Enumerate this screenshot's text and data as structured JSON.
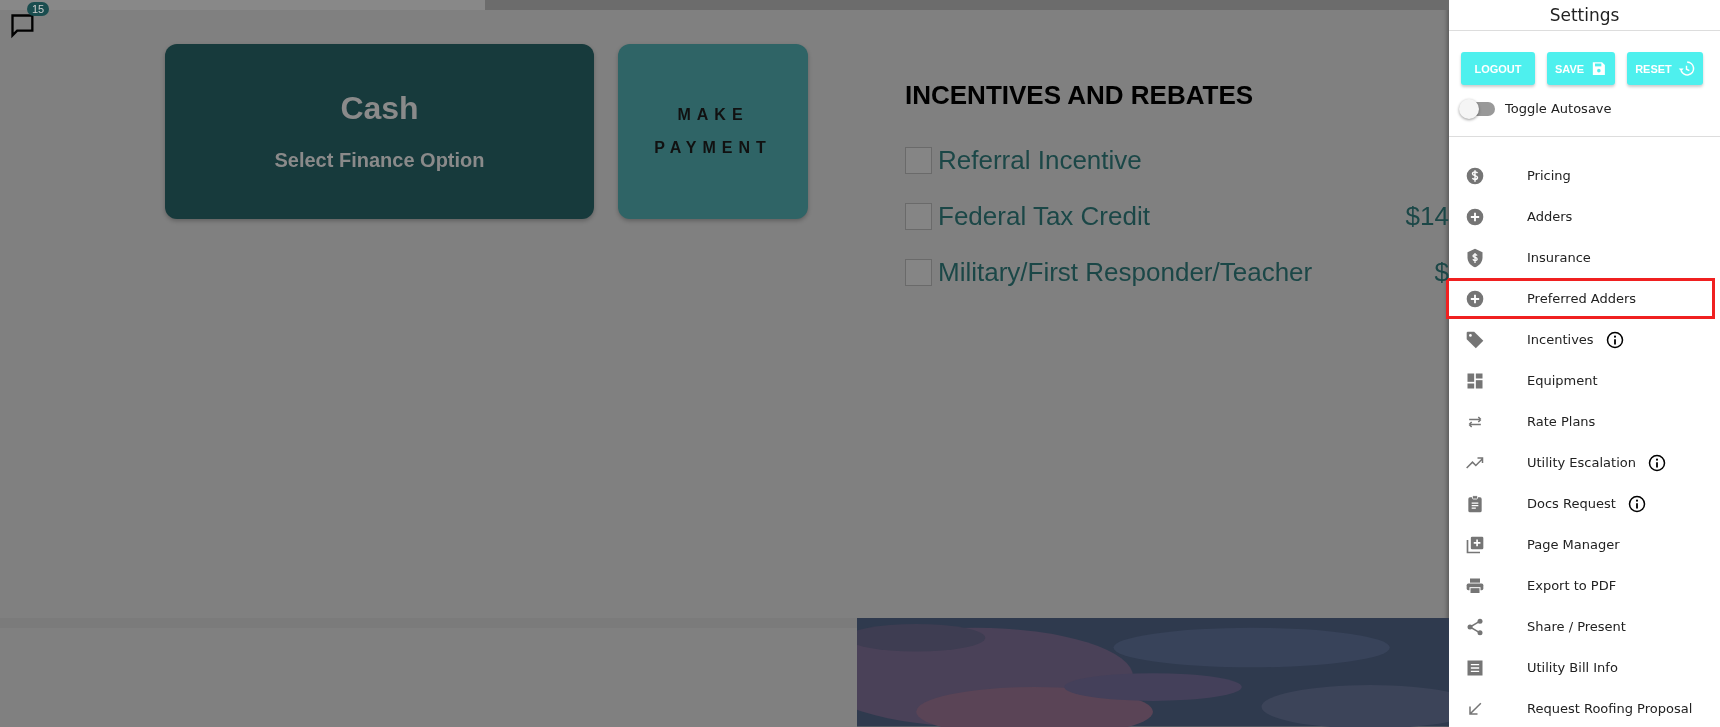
{
  "chat": {
    "badge": "15"
  },
  "finance_card": {
    "title": "Cash",
    "subtitle": "Select Finance Option"
  },
  "payment_button": {
    "label": "MAKE PAYMENT"
  },
  "incentives": {
    "title": "INCENTIVES AND REBATES",
    "rows": [
      {
        "label": "Referral Incentive",
        "checked": false
      },
      {
        "label": "Federal Tax Credit",
        "checked": false,
        "amount": "$14"
      },
      {
        "label": "Military/First Responder/Teacher",
        "checked": false,
        "amount": "$"
      }
    ]
  },
  "settings": {
    "title": "Settings",
    "buttons": [
      {
        "label": "LOGOUT",
        "kind": "plain"
      },
      {
        "label": "SAVE",
        "kind": "save"
      },
      {
        "label": "RESET",
        "kind": "reset"
      }
    ],
    "autosave": {
      "label": "Toggle Autosave",
      "on": false
    },
    "items": [
      {
        "label": "Pricing",
        "kind": "dollar",
        "info": false,
        "highlighted": false
      },
      {
        "label": "Adders",
        "kind": "plus",
        "info": false,
        "highlighted": false
      },
      {
        "label": "Insurance",
        "kind": "shield",
        "info": false,
        "highlighted": false
      },
      {
        "label": "Preferred Adders",
        "kind": "plus",
        "info": false,
        "highlighted": true
      },
      {
        "label": "Incentives",
        "kind": "tag",
        "info": true,
        "highlighted": false
      },
      {
        "label": "Equipment",
        "kind": "dashboard",
        "info": false,
        "highlighted": false
      },
      {
        "label": "Rate Plans",
        "kind": "swap",
        "info": false,
        "highlighted": false
      },
      {
        "label": "Utility Escalation",
        "kind": "trend",
        "info": true,
        "highlighted": false
      },
      {
        "label": "Docs Request",
        "kind": "clipboard",
        "info": true,
        "highlighted": false
      },
      {
        "label": "Page Manager",
        "kind": "library",
        "info": false,
        "highlighted": false
      },
      {
        "label": "Export to PDF",
        "kind": "print",
        "info": false,
        "highlighted": false
      },
      {
        "label": "Share / Present",
        "kind": "share",
        "info": false,
        "highlighted": false
      },
      {
        "label": "Utility Bill Info",
        "kind": "receipt",
        "info": false,
        "highlighted": false
      },
      {
        "label": "Request Roofing Proposal",
        "kind": "arrow",
        "info": false,
        "highlighted": false
      }
    ]
  }
}
